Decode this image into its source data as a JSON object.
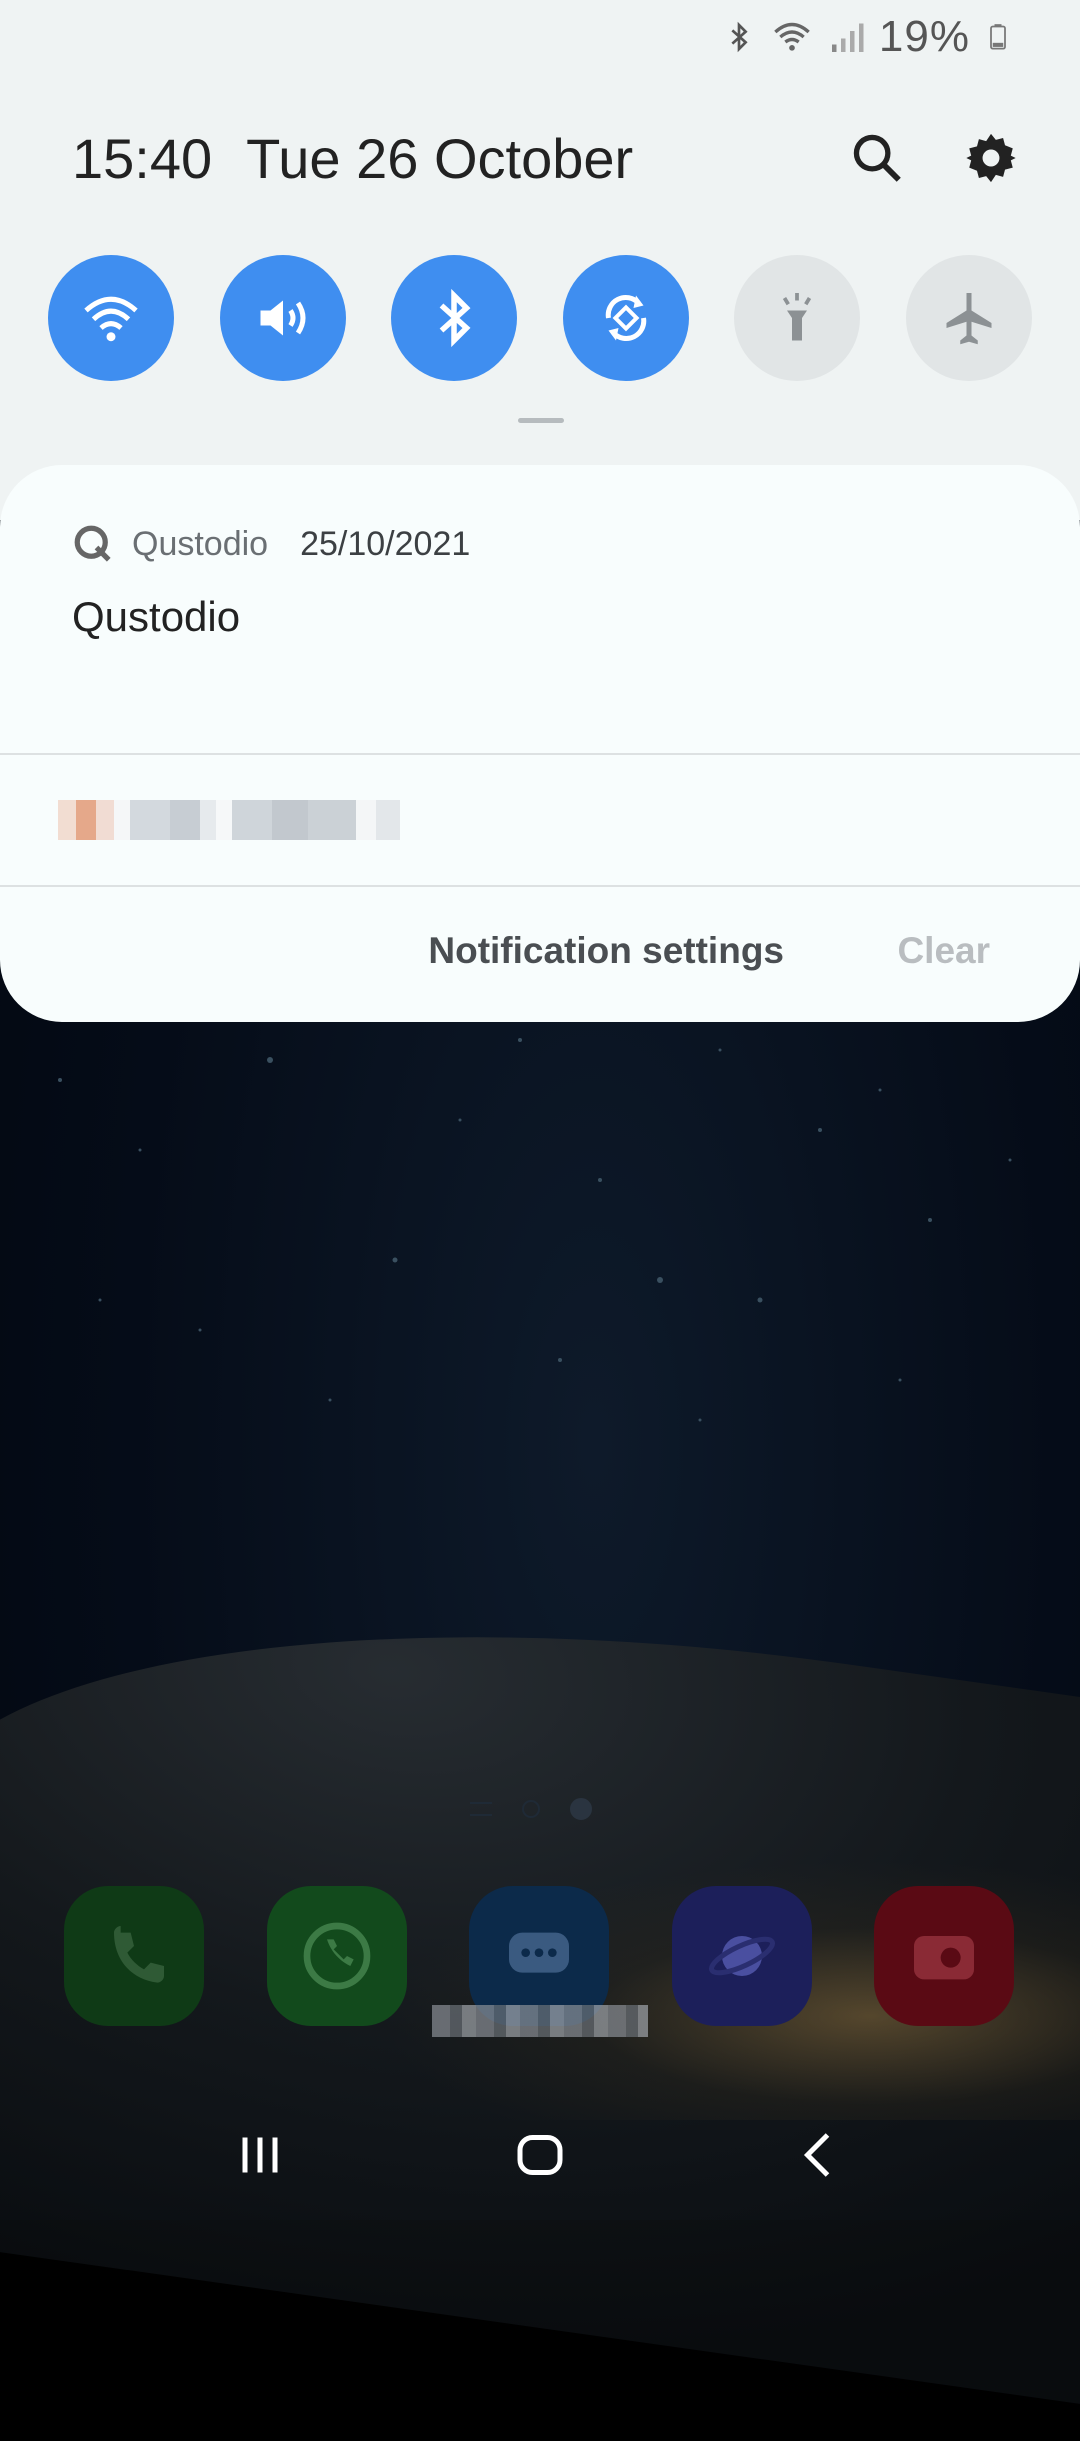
{
  "status_bar": {
    "battery_text": "19%",
    "icons": [
      "bluetooth-icon",
      "wifi-icon",
      "signal-icon",
      "battery-icon"
    ]
  },
  "header": {
    "time": "15:40",
    "date": "Tue 26 October",
    "search_icon": "search-icon",
    "settings_icon": "gear-icon"
  },
  "quick_settings": [
    {
      "name": "wifi",
      "icon": "wifi-icon",
      "state": "on"
    },
    {
      "name": "sound",
      "icon": "volume-icon",
      "state": "on"
    },
    {
      "name": "bluetooth",
      "icon": "bluetooth-icon",
      "state": "on"
    },
    {
      "name": "auto-rotate",
      "icon": "rotate-icon",
      "state": "on"
    },
    {
      "name": "flashlight",
      "icon": "flashlight-icon",
      "state": "off"
    },
    {
      "name": "airplane-mode",
      "icon": "airplane-icon",
      "state": "off"
    }
  ],
  "notification": {
    "app_name": "Qustodio",
    "date": "25/10/2021",
    "title": "Qustodio"
  },
  "actions": {
    "settings_label": "Notification settings",
    "clear_label": "Clear"
  },
  "dock": [
    "phone-icon",
    "whatsapp-icon",
    "messages-icon",
    "internet-icon",
    "camera-icon"
  ],
  "colors": {
    "tile_on": "#3f8ef0",
    "tile_off": "#e1e5e6",
    "panel_bg": "#eff3f3",
    "card_bg": "#f8fdfd"
  }
}
